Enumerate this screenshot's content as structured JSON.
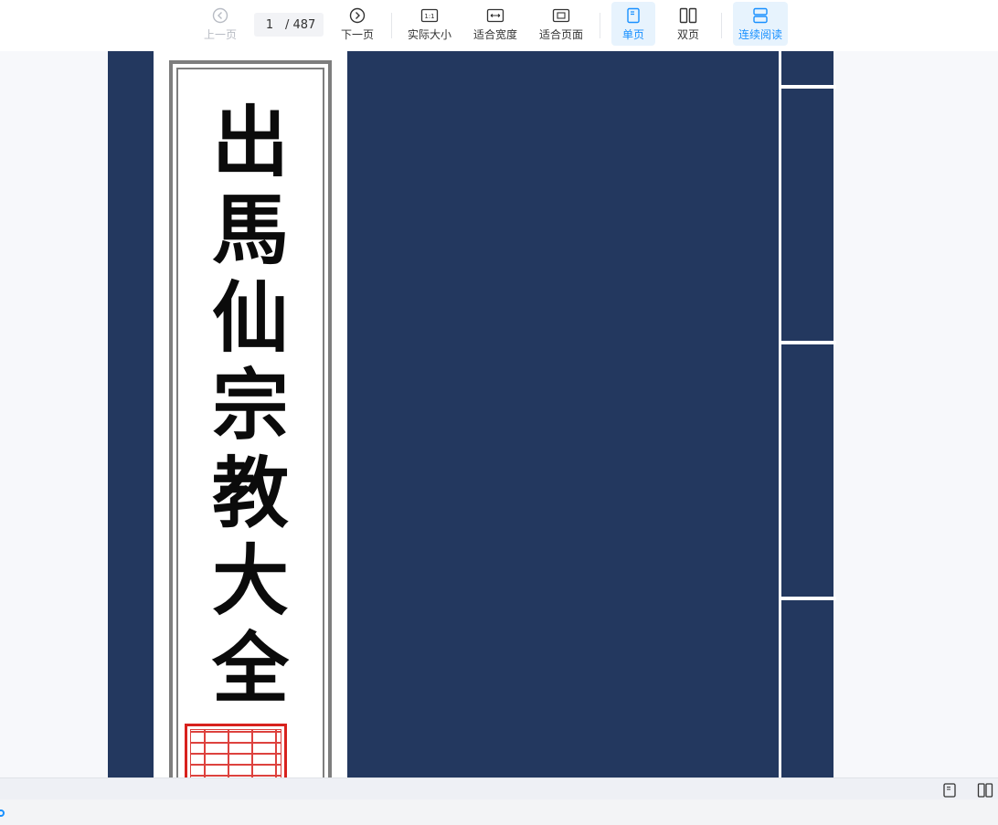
{
  "toolbar": {
    "prev_label": "上一页",
    "next_label": "下一页",
    "current_page": "1",
    "total_pages": "/ 487",
    "actual_size_label": "实际大小",
    "fit_width_label": "适合宽度",
    "fit_page_label": "适合页面",
    "single_page_label": "单页",
    "double_page_label": "双页",
    "continuous_label": "连续阅读",
    "actual_size_icon_text": "1:1",
    "active_color": "#1890ff"
  },
  "document": {
    "title_chars": [
      "出",
      "馬",
      "仙",
      "宗",
      "教",
      "大",
      "全"
    ],
    "cover_color": "#23385f",
    "seal_color": "#d8221d"
  },
  "statusbar": {
    "icons": [
      "single-page-icon",
      "double-page-icon"
    ]
  }
}
